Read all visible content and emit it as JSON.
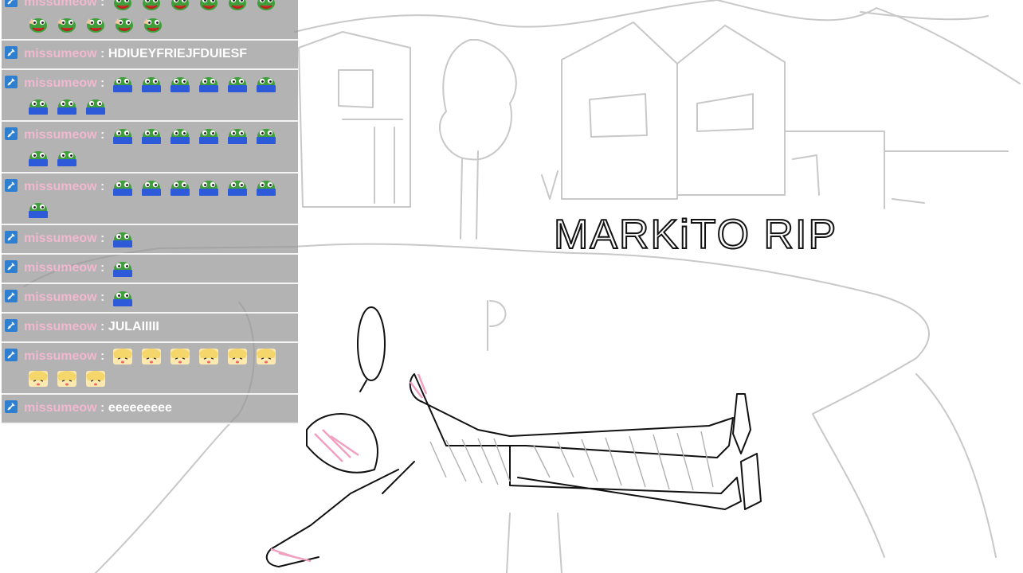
{
  "drawing": {
    "caption": "MARKiTO  RIP",
    "sign_letter": "P"
  },
  "chat": {
    "badge_icon": "moderator-sword-icon",
    "messages": [
      {
        "user": "missumeow",
        "sep": ":",
        "text": "",
        "emotes": [
          "pepe-crown",
          "pepe-crown",
          "pepe-crown",
          "pepe-crown",
          "pepe-crown",
          "pepe-crown",
          "pepe-hand",
          "pepe-hand",
          "pepe-hand",
          "pepe-hand",
          "pepe-hand"
        ]
      },
      {
        "user": "missumeow",
        "sep": ":",
        "text": "HDIUEYFRIEJFDUIESF",
        "emotes": []
      },
      {
        "user": "missumeow",
        "sep": ":",
        "text": "",
        "emotes": [
          "pepe-laptop",
          "pepe-laptop",
          "pepe-laptop",
          "pepe-laptop",
          "pepe-laptop",
          "pepe-laptop",
          "pepe-laptop",
          "pepe-laptop",
          "pepe-laptop"
        ]
      },
      {
        "user": "missumeow",
        "sep": ":",
        "text": "",
        "emotes": [
          "pepe-laptop",
          "pepe-laptop",
          "pepe-laptop",
          "pepe-laptop",
          "pepe-laptop",
          "pepe-laptop",
          "pepe-laptop",
          "pepe-laptop"
        ]
      },
      {
        "user": "missumeow",
        "sep": ":",
        "text": "",
        "emotes": [
          "pepe-laptop",
          "pepe-laptop",
          "pepe-laptop",
          "pepe-laptop",
          "pepe-laptop",
          "pepe-laptop",
          "pepe-laptop"
        ]
      },
      {
        "user": "missumeow",
        "sep": ":",
        "text": "",
        "emotes": [
          "pepe-laptop"
        ]
      },
      {
        "user": "missumeow",
        "sep": ":",
        "text": "",
        "emotes": [
          "pepe-laptop"
        ]
      },
      {
        "user": "missumeow",
        "sep": ":",
        "text": "",
        "emotes": [
          "pepe-laptop"
        ]
      },
      {
        "user": "missumeow",
        "sep": ":",
        "text": "JULAIIIII",
        "emotes": []
      },
      {
        "user": "missumeow",
        "sep": ":",
        "text": "",
        "emotes": [
          "anime-girl",
          "anime-girl",
          "anime-girl",
          "anime-girl",
          "anime-girl",
          "anime-girl",
          "anime-girl",
          "anime-girl",
          "anime-girl"
        ]
      },
      {
        "user": "missumeow",
        "sep": ":",
        "text": "eeeeeeeee",
        "emotes": []
      }
    ]
  }
}
